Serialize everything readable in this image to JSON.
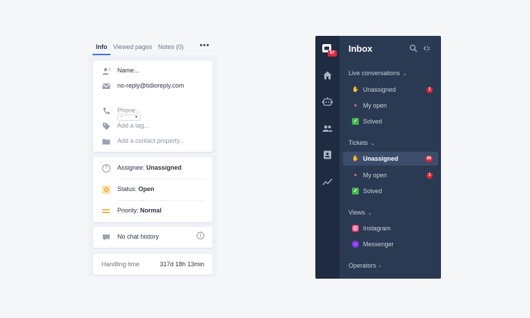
{
  "contact_panel": {
    "tabs": [
      {
        "label": "Info",
        "active": true
      },
      {
        "label": "Viewed pages",
        "active": false
      },
      {
        "label": "Notes (0)",
        "active": false
      }
    ],
    "more_label": "•••",
    "contact": {
      "name_placeholder": "Name...",
      "email": "no-reply@tidioreply.com",
      "email_select_value": "-",
      "phone_placeholder": "Phone...",
      "tag_placeholder": "Add a tag...",
      "property_placeholder": "Add a contact property..."
    },
    "ticket": {
      "assignee_label": "Assignee:",
      "assignee_value": "Unassigned",
      "status_label": "Status:",
      "status_value": "Open",
      "priority_label": "Priority:",
      "priority_value": "Normal"
    },
    "chat_history": "No chat history",
    "handling": {
      "label": "Handling time",
      "value": "317d 18h 13min"
    }
  },
  "inbox": {
    "title": "Inbox",
    "rail_badge": "87",
    "sections": [
      {
        "label": "Live conversations",
        "items": [
          {
            "label": "Unassigned",
            "icon": "wave",
            "count": "1",
            "active": false
          },
          {
            "label": "My open",
            "icon": "person",
            "count": "",
            "active": false
          },
          {
            "label": "Solved",
            "icon": "check",
            "count": "",
            "active": false
          }
        ]
      },
      {
        "label": "Tickets",
        "items": [
          {
            "label": "Unassigned",
            "icon": "wave",
            "count": "85",
            "active": true
          },
          {
            "label": "My open",
            "icon": "person",
            "count": "1",
            "active": false
          },
          {
            "label": "Solved",
            "icon": "check",
            "count": "",
            "active": false
          }
        ]
      },
      {
        "label": "Views",
        "items": [
          {
            "label": "Instagram",
            "icon": "instagram",
            "count": "",
            "active": false
          },
          {
            "label": "Messenger",
            "icon": "messenger",
            "count": "",
            "active": false
          }
        ]
      }
    ],
    "operators_label": "Operators",
    "colors": {
      "sidebar_bg": "#2b3a53",
      "rail_bg": "#1f2b40",
      "badge": "#e1263b",
      "active_item": "#3b4d6b",
      "accent": "#3d6ee8"
    }
  }
}
